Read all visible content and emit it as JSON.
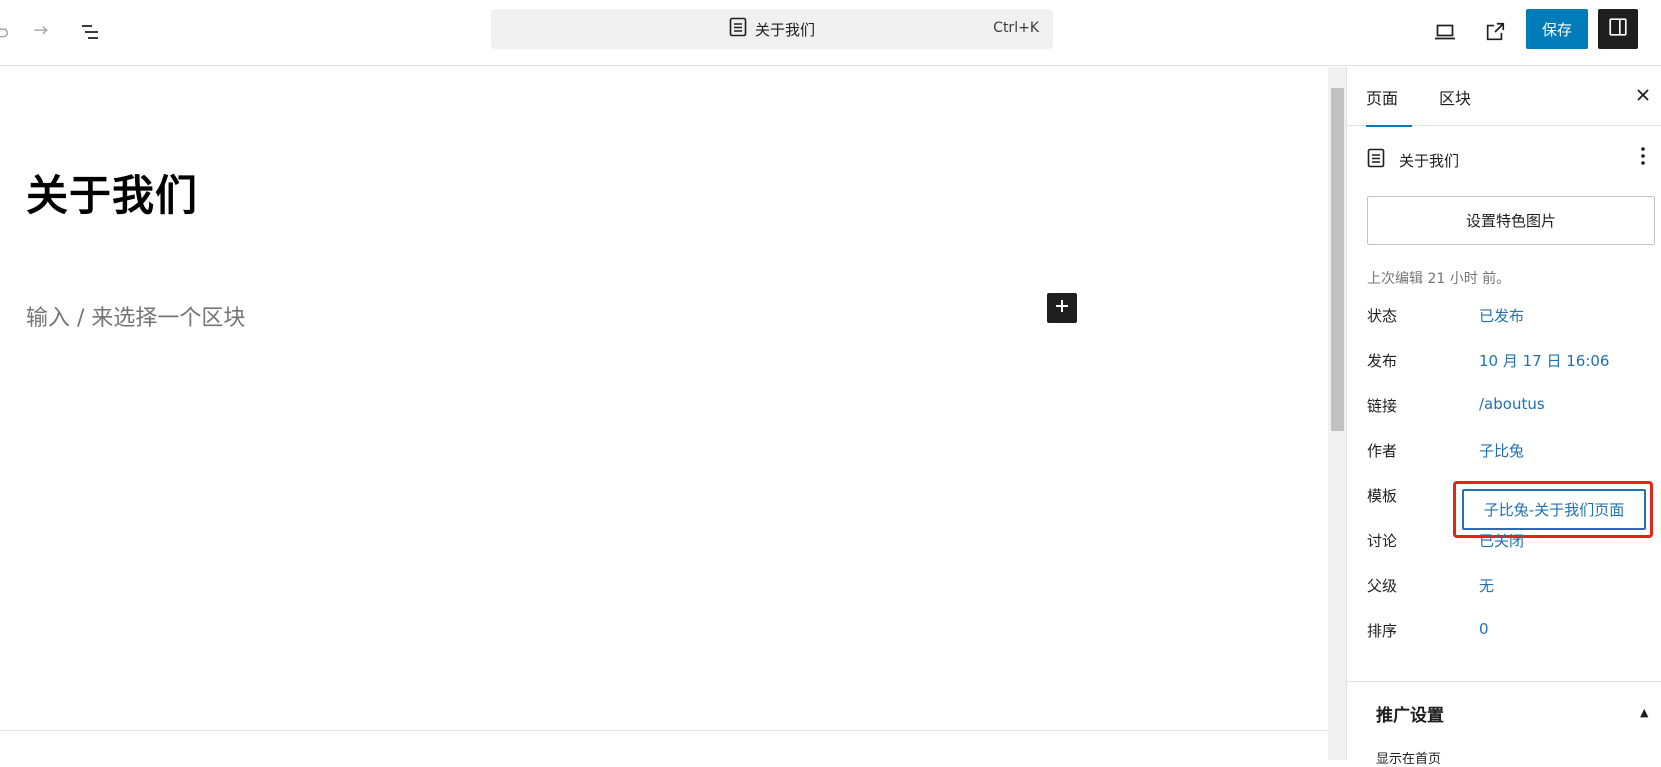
{
  "toolbar": {
    "document_title": "关于我们",
    "shortcut": "Ctrl+K",
    "save_label": "保存"
  },
  "editor": {
    "title": "关于我们",
    "placeholder": "输入 / 来选择一个区块"
  },
  "sidebar": {
    "tabs": [
      "页面",
      "区块"
    ],
    "active_tab": "页面",
    "document_name": "关于我们",
    "featured_image_label": "设置特色图片",
    "last_edited": "上次编辑 21 小时 前。",
    "rows": [
      {
        "label": "状态",
        "value": "已发布"
      },
      {
        "label": "发布",
        "value": "10 月 17 日 16:06"
      },
      {
        "label": "链接",
        "value": "/aboutus"
      },
      {
        "label": "作者",
        "value": "子比兔"
      },
      {
        "label": "模板",
        "value": "子比兔-关于我们页面"
      },
      {
        "label": "讨论",
        "value": "已关闭"
      },
      {
        "label": "父级",
        "value": "无"
      },
      {
        "label": "排序",
        "value": "0"
      }
    ],
    "panel_title": "推广设置",
    "panel_sub": "显示在首页"
  },
  "colors": {
    "accent": "#007cba",
    "link": "#2271b1",
    "highlight": "#e0261c"
  }
}
